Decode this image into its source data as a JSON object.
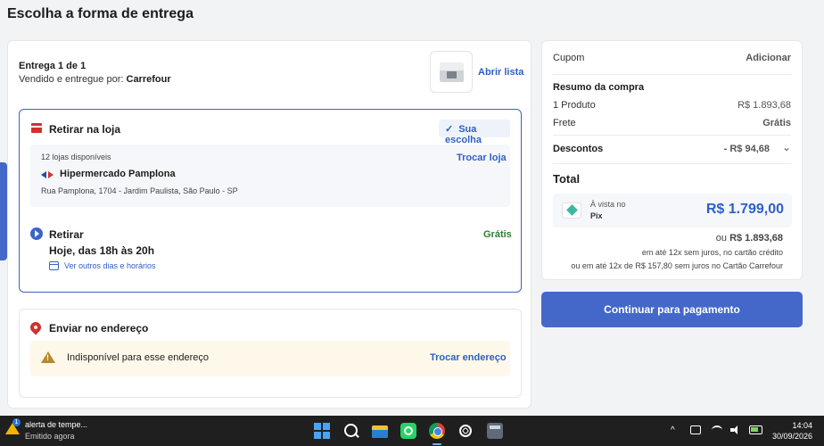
{
  "page": {
    "title": "Escolha a forma de entrega"
  },
  "delivery": {
    "heading": "Entrega 1 de 1",
    "seller_prefix": "Vendido e entregue por:",
    "seller_name": "Carrefour",
    "open_list": "Abrir lista"
  },
  "pickup": {
    "title": "Retirar na loja",
    "badge": "Sua escolha",
    "stores_count": "12 lojas disponíveis",
    "change_store": "Trocar loja",
    "store_name": "Hipermercado Pamplona",
    "store_address": "Rua Pamplona, 1704 - Jardim Paulista, São Paulo - SP",
    "withdraw_title": "Retirar",
    "withdraw_price": "Grátis",
    "withdraw_time": "Hoje, das 18h às 20h",
    "other_days": "Ver outros dias e horários"
  },
  "shipping": {
    "title": "Enviar no endereço",
    "warning": "Indisponível para esse endereço",
    "change_address": "Trocar endereço"
  },
  "summary": {
    "coupon_label": "Cupom",
    "coupon_action": "Adicionar",
    "heading": "Resumo da compra",
    "product_label": "1 Produto",
    "product_value": "R$ 1.893,68",
    "shipping_label": "Frete",
    "shipping_value": "Grátis",
    "discount_label": "Descontos",
    "discount_value": "- R$ 94,68",
    "total_label": "Total",
    "pix_small": "À vista no",
    "pix_label": "Pix",
    "pix_price": "R$ 1.799,00",
    "or_prefix": "ou",
    "or_price": "R$ 1.893,68",
    "installments_card": "em até 12x sem juros, no cartão crédito",
    "installments_carrefour": "ou em até 12x de R$ 157,80 sem juros no Cartão Carrefour",
    "cta": "Continuar para pagamento"
  },
  "taskbar": {
    "alert_title": "alerta de tempe...",
    "alert_sub": "Emitido agora",
    "time": "14:04",
    "date": "30/09/2026"
  },
  "colors": {
    "accent": "#4468c9",
    "link": "#2e5fc7",
    "success": "#2e7d32",
    "danger": "#d0312d",
    "warning_bg": "#fdf8ea"
  }
}
